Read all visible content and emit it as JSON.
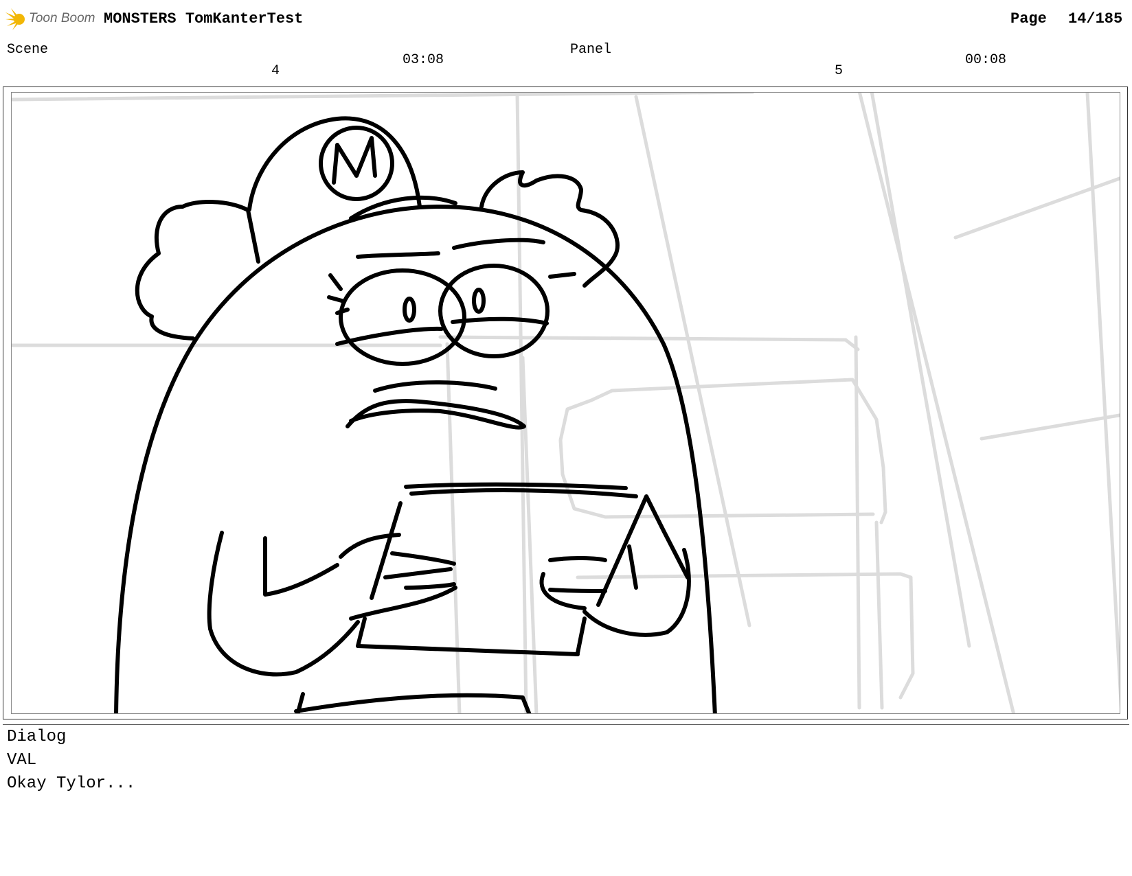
{
  "header": {
    "logo_text": "Toon Boom",
    "project_title": "MONSTERS TomKanterTest",
    "page_label": "Page",
    "page_number": "14/185"
  },
  "scene": {
    "label": "Scene",
    "number": "4",
    "duration": "03:08"
  },
  "panel": {
    "label": "Panel",
    "number": "5",
    "duration": "00:08"
  },
  "dialog": {
    "label": "Dialog",
    "character": "VAL",
    "line": "Okay Tylor..."
  },
  "colors": {
    "logo_accent": "#f2b705",
    "sketch_line": "#000000",
    "background_sketch": "#d9d9d9",
    "frame_border": "#8a8a8a"
  }
}
